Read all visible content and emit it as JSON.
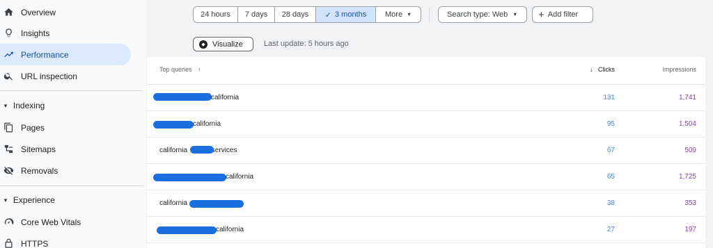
{
  "sidebar": {
    "items": [
      {
        "label": "Overview",
        "icon": "home-icon"
      },
      {
        "label": "Insights",
        "icon": "lightbulb-icon"
      },
      {
        "label": "Performance",
        "icon": "trending-up-icon",
        "active": true
      },
      {
        "label": "URL inspection",
        "icon": "search-icon"
      }
    ],
    "indexing": {
      "label": "Indexing",
      "items": [
        {
          "label": "Pages",
          "icon": "pages-icon"
        },
        {
          "label": "Sitemaps",
          "icon": "sitemap-icon"
        },
        {
          "label": "Removals",
          "icon": "eye-off-icon"
        }
      ]
    },
    "experience": {
      "label": "Experience",
      "items": [
        {
          "label": "Core Web Vitals",
          "icon": "gauge-icon"
        },
        {
          "label": "HTTPS",
          "icon": "lock-icon"
        }
      ]
    }
  },
  "toolbar": {
    "ranges": [
      "24 hours",
      "7 days",
      "28 days",
      "3 months"
    ],
    "selected_range": "3 months",
    "more_label": "More",
    "search_type_label": "Search type: Web",
    "add_filter_label": "Add filter",
    "visualize_label": "Visualize",
    "last_update": "Last update: 5 hours ago"
  },
  "table": {
    "headers": {
      "queries": "Top queries",
      "clicks": "Clicks",
      "impressions": "Impressions"
    },
    "rows": [
      {
        "query": "california",
        "clicks": "131",
        "impressions": "1,741"
      },
      {
        "query": "california",
        "clicks": "95",
        "impressions": "1,504"
      },
      {
        "query": "california services",
        "clicks": "67",
        "impressions": "509"
      },
      {
        "query": "california",
        "clicks": "65",
        "impressions": "1,725"
      },
      {
        "query": "california",
        "clicks": "38",
        "impressions": "353"
      },
      {
        "query": "california",
        "clicks": "27",
        "impressions": "197"
      }
    ]
  },
  "colors": {
    "active_nav_bg": "#dbeafc",
    "selected_chip_bg": "#d2e3fc",
    "clicks_text": "#4a86d0",
    "impressions_text": "#8a3ea0",
    "redaction": "#1a6fe0"
  }
}
